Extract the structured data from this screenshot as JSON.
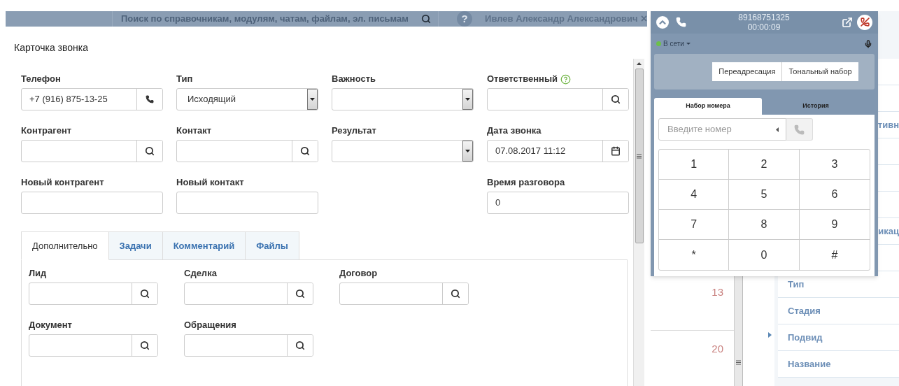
{
  "top_bar": {
    "search_placeholder": "Поиск по справочникам, модулям, чатам, файлам, эл. письмам",
    "help": "?",
    "user": "Ивлев Александр Александрович",
    "close": "×"
  },
  "card": {
    "title": "Карточка звонка",
    "rows": [
      [
        {
          "label": "Телефон",
          "kind": "phone",
          "value": "+7 (916) 875-13-25"
        },
        {
          "label": "Тип",
          "kind": "select",
          "value": "Исходящий"
        },
        {
          "label": "Важность",
          "kind": "select"
        },
        {
          "label": "Ответственный",
          "kind": "search",
          "help": true
        }
      ],
      [
        {
          "label": "Контрагент",
          "kind": "search"
        },
        {
          "label": "Контакт",
          "kind": "search"
        },
        {
          "label": "Результат",
          "kind": "select"
        },
        {
          "label": "Дата звонка",
          "kind": "date",
          "value": "07.08.2017 11:12"
        }
      ],
      [
        {
          "label": "Новый контрагент",
          "kind": "text"
        },
        {
          "label": "Новый контакт",
          "kind": "text"
        },
        null,
        {
          "label": "Время разговора",
          "kind": "text",
          "value": "0"
        }
      ]
    ],
    "tabs": [
      {
        "label": "Дополнительно",
        "selected": true
      },
      {
        "label": "Задачи",
        "selected": false
      },
      {
        "label": "Комментарий",
        "selected": false
      },
      {
        "label": "Файлы",
        "selected": false
      }
    ],
    "tab_rows": [
      [
        {
          "label": "Лид",
          "kind": "search"
        },
        {
          "label": "Сделка",
          "kind": "search"
        },
        {
          "label": "Договор",
          "kind": "search"
        }
      ],
      [
        {
          "label": "Документ",
          "kind": "search"
        },
        {
          "label": "Обращения",
          "kind": "search"
        }
      ]
    ]
  },
  "calendar": {
    "days": [
      "13",
      "20"
    ]
  },
  "background_rows": [
    null,
    null,
    {
      "text": "тивн",
      "partial": true
    },
    null,
    null,
    null,
    {
      "text": "икац",
      "partial": true
    },
    null,
    {
      "text": "Тип",
      "partial": false
    },
    {
      "text": "Стадия",
      "partial": false
    },
    {
      "text": "Подвид",
      "partial": false
    },
    {
      "text": "Название",
      "partial": false
    }
  ],
  "phone": {
    "number": "89168751325",
    "timer": "00:00:09",
    "status": {
      "label": "В сети",
      "online": true
    },
    "actions": [
      "Переадресация",
      "Тональный набор"
    ],
    "tabs": [
      {
        "label": "Набор номера",
        "selected": true
      },
      {
        "label": "История",
        "selected": false
      }
    ],
    "input_placeholder": "Введите номер",
    "keys": [
      "1",
      "2",
      "3",
      "4",
      "5",
      "6",
      "7",
      "8",
      "9",
      "*",
      "0",
      "#"
    ]
  }
}
